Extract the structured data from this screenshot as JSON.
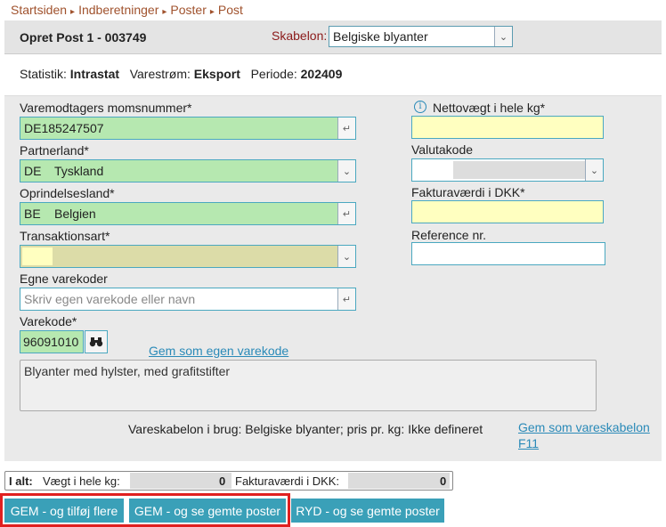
{
  "breadcrumbs": [
    "Startsiden",
    "Indberetninger",
    "Poster",
    "Post"
  ],
  "header": {
    "title": "Opret Post 1 - 003749",
    "template_label": "Skabelon:",
    "template_value": "Belgiske blyanter"
  },
  "status": {
    "statistic_label": "Statistik:",
    "statistic_value": "Intrastat",
    "flow_label": "Varestrøm:",
    "flow_value": "Eksport",
    "period_label": "Periode:",
    "period_value": "202409"
  },
  "form": {
    "vat_label": "Varemodtagers momsnummer*",
    "vat_value": "DE185247507",
    "partner_label": "Partnerland*",
    "partner_code": "DE",
    "partner_name": "Tyskland",
    "origin_label": "Oprindelsesland*",
    "origin_code": "BE",
    "origin_name": "Belgien",
    "transaction_label": "Transaktionsart*",
    "own_codes_label": "Egne varekoder",
    "own_codes_placeholder": "Skriv egen varekode eller navn",
    "commodity_label": "Varekode*",
    "commodity_value": "96091010",
    "save_own_code_link": "Gem som egen varekode",
    "description": "Blyanter med hylster, med grafitstifter",
    "net_weight_label": "Nettovægt i hele kg*",
    "currency_label": "Valutakode",
    "invoice_label": "Fakturaværdi i DKK*",
    "reference_label": "Reference nr.",
    "template_info": "Vareskabelon i brug: Belgiske blyanter; pris pr. kg: Ikke defineret",
    "save_template_link": "Gem som vareskabelon",
    "save_template_shortcut": "F11"
  },
  "totals": {
    "label": "I alt:",
    "weight_label": "Vægt i hele kg:",
    "weight_value": "0",
    "invoice_label": "Fakturaværdi i DKK:",
    "invoice_value": "0"
  },
  "buttons": {
    "save_add": "GEM - og tilføj flere",
    "save_view": "GEM - og se gemte poster",
    "clear_view": "RYD - og se gemte poster"
  },
  "colors": {
    "accent": "#3aa0b8",
    "highlight": "#e02020",
    "green_field": "#b6e8b0",
    "yellow_field": "#ffffc0"
  }
}
